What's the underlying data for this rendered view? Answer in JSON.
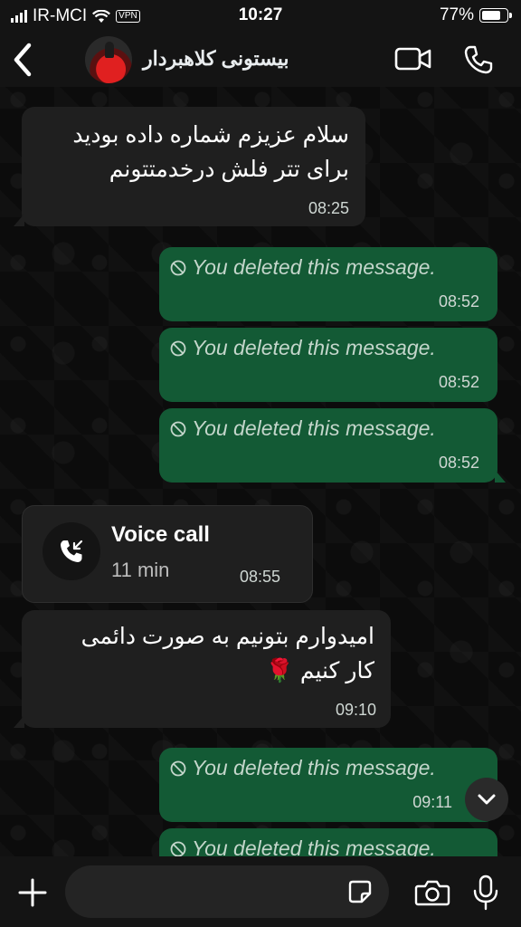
{
  "status_bar": {
    "carrier": "IR-MCI",
    "vpn_label": "VPN",
    "time": "10:27",
    "battery": "77%",
    "battery_level": 0.77
  },
  "header": {
    "contact_name": "بیستونی کلاهبردار",
    "back_icon": "chevron-left-icon",
    "video_icon": "video-camera-icon",
    "call_icon": "phone-icon"
  },
  "messages": [
    {
      "type": "incoming",
      "lines": [
        "سلام عزیزم شماره داده بودید",
        "برای تتر فلش درخدمتتونم"
      ],
      "time": "08:25"
    },
    {
      "type": "outgoing_deleted",
      "text": "You deleted this message.",
      "time": "08:52"
    },
    {
      "type": "outgoing_deleted",
      "text": "You deleted this message.",
      "time": "08:52"
    },
    {
      "type": "outgoing_deleted",
      "text": "You deleted this message.",
      "time": "08:52"
    },
    {
      "type": "voice_call",
      "title": "Voice call",
      "duration": "11 min",
      "time": "08:55"
    },
    {
      "type": "incoming",
      "lines": [
        "امیدوارم بتونیم به صورت دائمی",
        "کار کنیم 🌹"
      ],
      "time": "09:10"
    },
    {
      "type": "outgoing_deleted",
      "text": "You deleted this message.",
      "time": "09:11"
    },
    {
      "type": "outgoing_deleted",
      "text": "You deleted this message.",
      "time": ""
    }
  ],
  "composer": {
    "placeholder": ""
  },
  "colors": {
    "outgoing_bubble": "#135a35",
    "incoming_bubble": "#1f1f1f",
    "background": "#0b0b0b"
  }
}
